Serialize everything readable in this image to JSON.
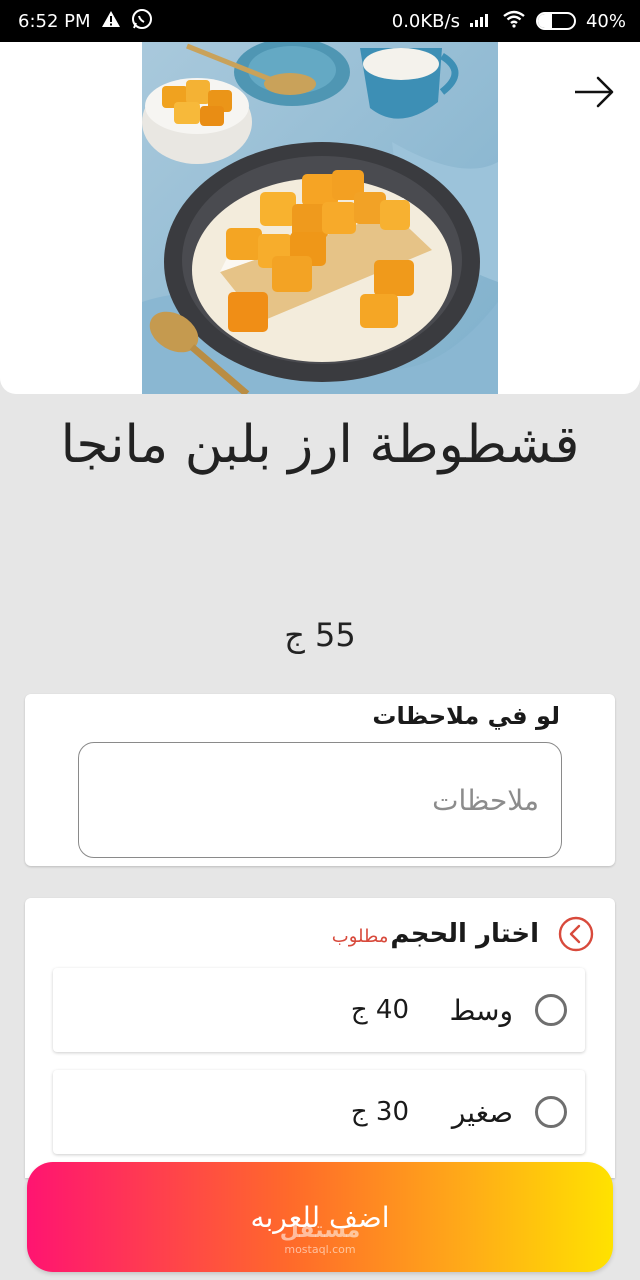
{
  "status_bar": {
    "time": "6:52 PM",
    "network_speed": "0.0KB/s",
    "battery": "40%",
    "battery_level": 0.4,
    "icons": [
      "warning-icon",
      "whatsapp-icon",
      "signal-icon",
      "wifi-icon",
      "battery-icon"
    ]
  },
  "product": {
    "title": "قشطوطة ارز بلبن مانجا",
    "price": "55 ج",
    "image": "mango-rice-pudding-photo"
  },
  "notes": {
    "heading": "لو في ملاحظات",
    "placeholder": "ملاحظات",
    "value": ""
  },
  "size": {
    "title": "اختار الحجم",
    "required": "مطلوب",
    "options": [
      {
        "name": "وسط",
        "price": "40 ج",
        "selected": false
      },
      {
        "name": "صغير",
        "price": "30 ج",
        "selected": false
      }
    ]
  },
  "actions": {
    "add_to_cart": "اضف للعربه"
  },
  "watermark": {
    "text": "مستقل",
    "sub": "mostaql.com"
  },
  "colors": {
    "background": "#e6e6e6",
    "required_red": "#d84a3c",
    "button_gradient_start": "#ff1471",
    "button_gradient_end": "#ffe200"
  }
}
